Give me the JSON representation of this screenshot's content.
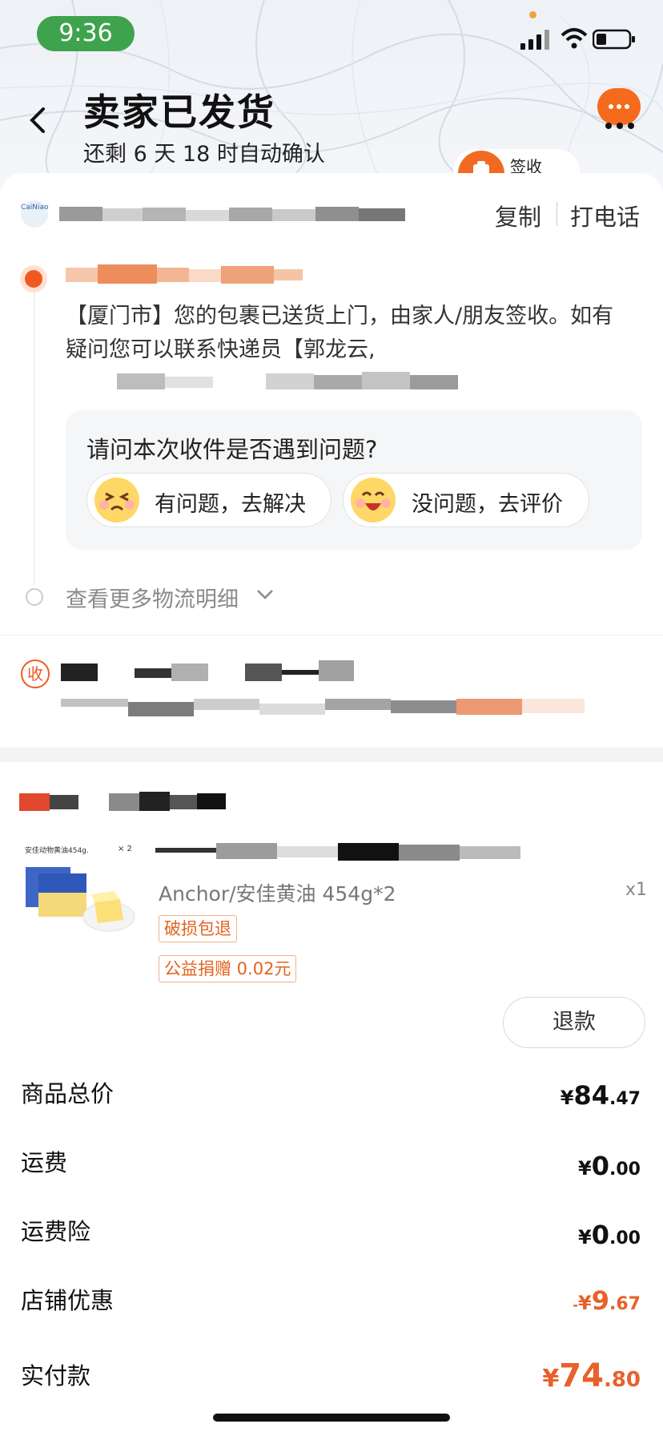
{
  "status_bar": {
    "time": "9:36"
  },
  "header": {
    "title": "卖家已发货",
    "subtitle": "还剩 6 天 18 时自动确认",
    "sign_label": "签收"
  },
  "courier": {
    "logo_text": "CaiNiao",
    "copy_label": "复制",
    "call_label": "打电话"
  },
  "tracking": {
    "latest_text": "【厦门市】您的包裹已送货上门，由家人/朋友签收。如有疑问您可以联系快递员【郭龙云,",
    "question": "请问本次收件是否遇到问题?",
    "option_problem": "有问题，去解决",
    "option_ok": "没问题，去评价",
    "more_link": "查看更多物流明细"
  },
  "receiver": {
    "badge": "收"
  },
  "product": {
    "image_caption": "安佳动物黄油454g.",
    "image_count": "× 2",
    "name": "Anchor/安佳黄油 454g*2",
    "quantity": "x1",
    "tags": [
      "破损包退",
      "公益捐赠 0.02元"
    ],
    "refund_label": "退款"
  },
  "prices": [
    {
      "label": "商品总价",
      "currency": "¥",
      "int": "84",
      "dec": ".47",
      "prefix": "",
      "color": "#111111"
    },
    {
      "label": "运费",
      "currency": "¥",
      "int": "0",
      "dec": ".00",
      "prefix": "",
      "color": "#111111"
    },
    {
      "label": "运费险",
      "currency": "¥",
      "int": "0",
      "dec": ".00",
      "prefix": "",
      "color": "#111111"
    },
    {
      "label": "店铺优惠",
      "currency": "¥",
      "int": "9",
      "dec": ".67",
      "prefix": "-",
      "color": "#e8602a"
    },
    {
      "label": "实付款",
      "currency": "¥",
      "int": "74",
      "dec": ".80",
      "prefix": "",
      "color": "#e8602a"
    }
  ],
  "colors": {
    "accent": "#f05a22",
    "status_green": "#3fa34d"
  }
}
